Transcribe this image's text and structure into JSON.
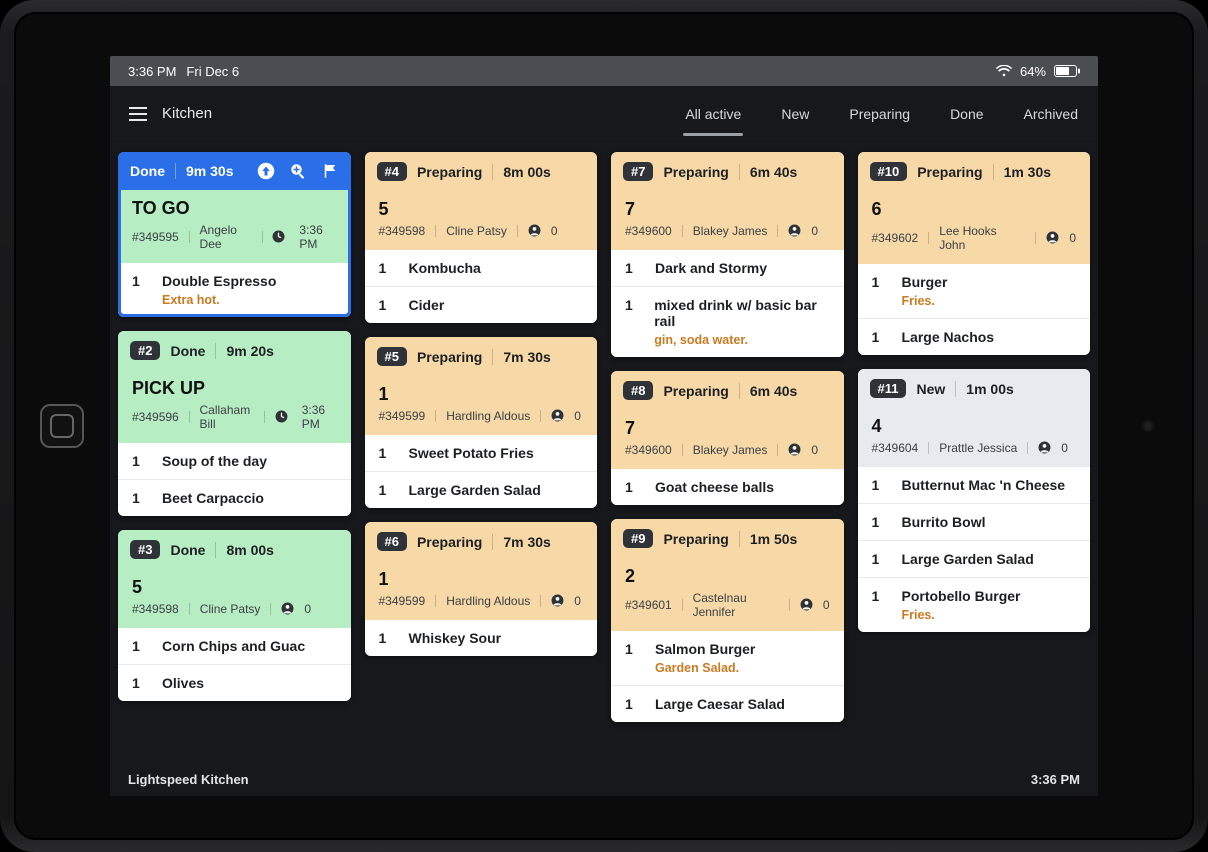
{
  "status": {
    "time": "3:36 PM",
    "date": "Fri Dec 6",
    "battery": "64%"
  },
  "header": {
    "title": "Kitchen",
    "tabs": [
      "All active",
      "New",
      "Preparing",
      "Done",
      "Archived"
    ],
    "active_tab_index": 0
  },
  "footer": {
    "brand": "Lightspeed Kitchen",
    "clock": "3:36 PM"
  },
  "columns": [
    [
      {
        "id": "c1",
        "highlight": true,
        "hdr_style": "done-primary",
        "status": "Done",
        "timer": "9m 30s",
        "show_action_icons": true,
        "sub_style": "done-sub",
        "destination": "TO GO",
        "order_no": "#349595",
        "customer": "Angelo Dee",
        "trail_is_time": true,
        "trail": "3:36 PM",
        "items": [
          {
            "qty": "1",
            "name": "Double Espresso",
            "mod": "Extra hot."
          }
        ]
      },
      {
        "id": "c2",
        "hdr_style": "done",
        "num": "#2",
        "status": "Done",
        "timer": "9m 20s",
        "sub_style": "done-sub",
        "destination": "PICK UP",
        "order_no": "#349596",
        "customer": "Callaham Bill",
        "trail_is_time": true,
        "trail": "3:36 PM",
        "items": [
          {
            "qty": "1",
            "name": "Soup of the day"
          },
          {
            "qty": "1",
            "name": "Beet Carpaccio"
          }
        ]
      },
      {
        "id": "c3",
        "hdr_style": "done",
        "num": "#3",
        "status": "Done",
        "timer": "8m 00s",
        "sub_style": "done-sub",
        "destination": "5",
        "order_no": "#349598",
        "customer": "Cline Patsy",
        "trail_is_time": false,
        "trail": "0",
        "items": [
          {
            "qty": "1",
            "name": "Corn Chips and Guac"
          },
          {
            "qty": "1",
            "name": "Olives"
          }
        ]
      }
    ],
    [
      {
        "id": "c4",
        "hdr_style": "preparing",
        "num": "#4",
        "status": "Preparing",
        "timer": "8m 00s",
        "sub_style": "prep-sub",
        "destination": "5",
        "order_no": "#349598",
        "customer": "Cline Patsy",
        "trail_is_time": false,
        "trail": "0",
        "items": [
          {
            "qty": "1",
            "name": "Kombucha"
          },
          {
            "qty": "1",
            "name": "Cider"
          }
        ]
      },
      {
        "id": "c5",
        "hdr_style": "preparing",
        "num": "#5",
        "status": "Preparing",
        "timer": "7m 30s",
        "sub_style": "prep-sub",
        "destination": "1",
        "order_no": "#349599",
        "customer": "Hardling Aldous",
        "trail_is_time": false,
        "trail": "0",
        "items": [
          {
            "qty": "1",
            "name": "Sweet Potato Fries"
          },
          {
            "qty": "1",
            "name": "Large Garden Salad"
          }
        ]
      },
      {
        "id": "c6",
        "hdr_style": "preparing",
        "num": "#6",
        "status": "Preparing",
        "timer": "7m 30s",
        "sub_style": "prep-sub",
        "destination": "1",
        "order_no": "#349599",
        "customer": "Hardling Aldous",
        "trail_is_time": false,
        "trail": "0",
        "items": [
          {
            "qty": "1",
            "name": "Whiskey Sour"
          }
        ]
      }
    ],
    [
      {
        "id": "c7",
        "hdr_style": "preparing",
        "num": "#7",
        "status": "Preparing",
        "timer": "6m 40s",
        "sub_style": "prep-sub",
        "destination": "7",
        "order_no": "#349600",
        "customer": "Blakey James",
        "trail_is_time": false,
        "trail": "0",
        "items": [
          {
            "qty": "1",
            "name": "Dark and Stormy"
          },
          {
            "qty": "1",
            "name": "mixed drink w/ basic bar rail",
            "mod": "gin, soda water."
          }
        ]
      },
      {
        "id": "c8",
        "hdr_style": "preparing",
        "num": "#8",
        "status": "Preparing",
        "timer": "6m 40s",
        "sub_style": "prep-sub",
        "destination": "7",
        "order_no": "#349600",
        "customer": "Blakey James",
        "trail_is_time": false,
        "trail": "0",
        "items": [
          {
            "qty": "1",
            "name": "Goat cheese balls"
          }
        ]
      },
      {
        "id": "c9",
        "hdr_style": "preparing",
        "num": "#9",
        "status": "Preparing",
        "timer": "1m 50s",
        "sub_style": "prep-sub",
        "destination": "2",
        "order_no": "#349601",
        "customer": "Castelnau Jennifer",
        "trail_is_time": false,
        "trail": "0",
        "items": [
          {
            "qty": "1",
            "name": "Salmon Burger",
            "mod": "Garden Salad."
          },
          {
            "qty": "1",
            "name": "Large Caesar Salad"
          }
        ]
      }
    ],
    [
      {
        "id": "c10",
        "hdr_style": "preparing",
        "num": "#10",
        "status": "Preparing",
        "timer": "1m 30s",
        "sub_style": "prep-sub",
        "destination": "6",
        "order_no": "#349602",
        "customer": "Lee Hooks John",
        "trail_is_time": false,
        "trail": "0",
        "items": [
          {
            "qty": "1",
            "name": "Burger",
            "mod": "Fries."
          },
          {
            "qty": "1",
            "name": "Large Nachos"
          }
        ]
      },
      {
        "id": "c11",
        "hdr_style": "new",
        "num": "#11",
        "status": "New",
        "timer": "1m 00s",
        "sub_style": "new-sub",
        "destination": "4",
        "order_no": "#349604",
        "customer": "Prattle Jessica",
        "trail_is_time": false,
        "trail": "0",
        "items": [
          {
            "qty": "1",
            "name": "Butternut Mac 'n Cheese"
          },
          {
            "qty": "1",
            "name": "Burrito Bowl"
          },
          {
            "qty": "1",
            "name": "Large Garden Salad"
          },
          {
            "qty": "1",
            "name": "Portobello Burger",
            "mod": "Fries."
          }
        ]
      }
    ]
  ]
}
